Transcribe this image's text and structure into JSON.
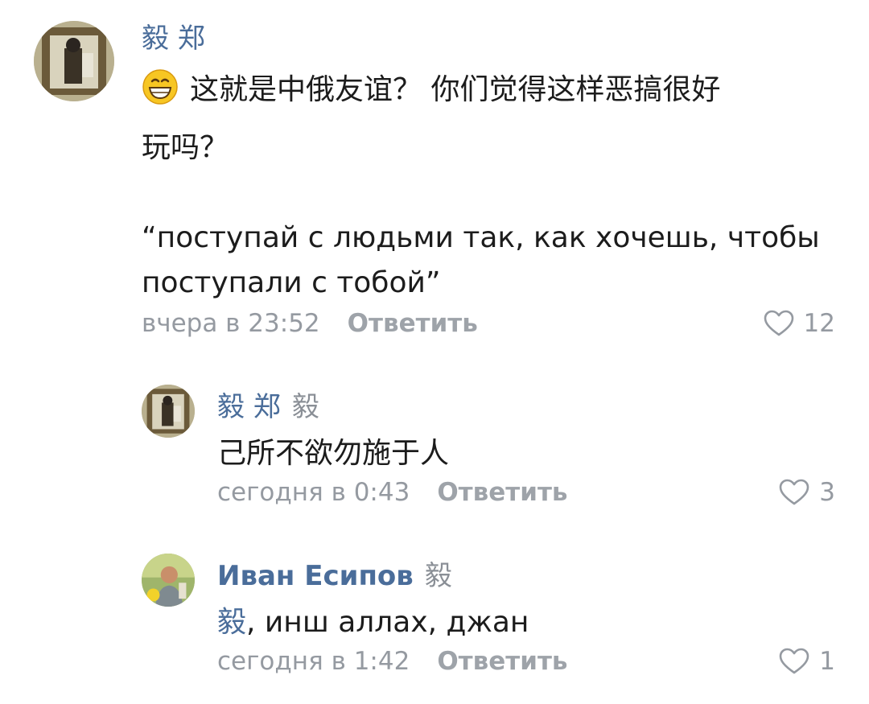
{
  "comments": [
    {
      "author": "毅 郑",
      "emoji_icon": "grinning-face-icon",
      "text_line1": "这就是中俄友谊？ 你们觉得这样恶搞很好",
      "text_line2": "玩吗？",
      "quote_line1": "“поступай с людьми так, как хочешь, чтобы",
      "quote_line2": "поступали с тобой”",
      "time": "вчера в 23:52",
      "reply_label": "Ответить",
      "likes": "12"
    },
    {
      "author": "毅 郑",
      "reply_to": "毅",
      "text": "己所不欲勿施于人",
      "time": "сегодня в 0:43",
      "reply_label": "Ответить",
      "likes": "3"
    },
    {
      "author": "Иван Есипов",
      "reply_to": "毅",
      "mention": "毅",
      "text_rest": ", инш аллах, джан",
      "time": "сегодня в 1:42",
      "reply_label": "Ответить",
      "likes": "1"
    }
  ],
  "colors": {
    "author": "#4a6d9a",
    "meta": "#959aa1",
    "text": "#1c1c1c",
    "background": "#ffffff"
  }
}
